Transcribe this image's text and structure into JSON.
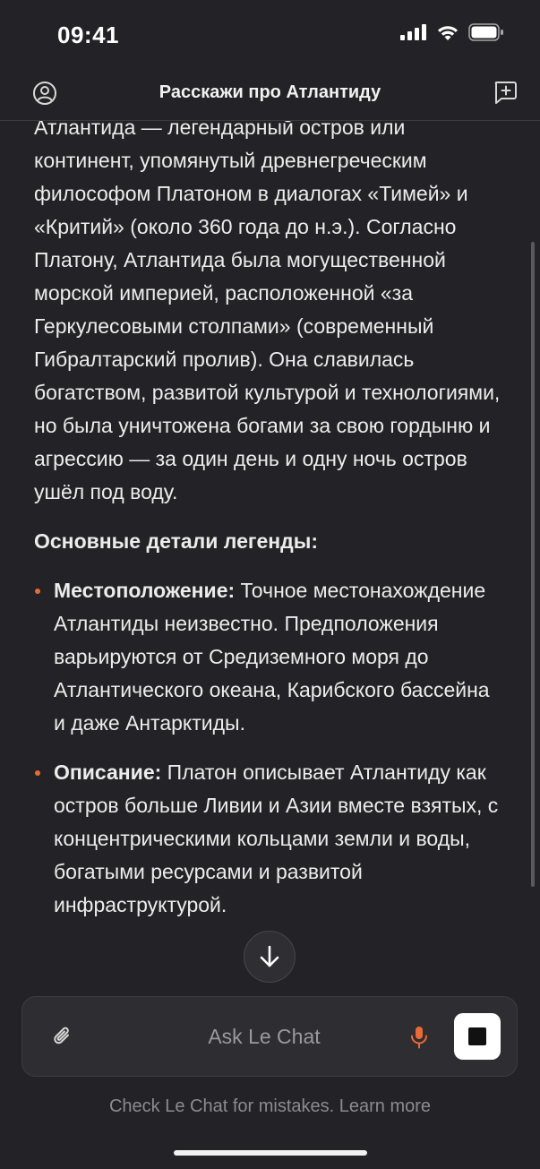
{
  "status_bar": {
    "time": "09:41"
  },
  "header": {
    "title": "Расскажи про Атлантиду"
  },
  "message": {
    "intro": "Атлантида — легендарный остров или континент, упомянутый древнегреческим философом Платоном в диалогах «Тимей» и «Критий» (около 360 года до н.э.). Согласно Платону, Атлантида была могущественной морской империей, расположенной «за Геркулесовыми столпами» (современный Гибралтарский пролив). Она славилась богатством, развитой культурой и технологиями, но была уничтожена богами за свою гордыню и агрессию — за один день и одну ночь остров ушёл под воду.",
    "section_heading": "Основные детали легенды:",
    "bullets": [
      {
        "label": "Местоположение:",
        "text": " Точное местонахождение Атлантиды неизвестно. Предположения варьируются от Средиземного моря до Атлантического океана, Карибского бассейна и даже Антарктиды."
      },
      {
        "label": "Описание:",
        "text": " Платон описывает Атлантиду как остров больше Ливии и Азии вместе взятых, с концентрическими кольцами земли и воды, богатыми ресурсами и развитой инфраструктурой."
      }
    ]
  },
  "composer": {
    "placeholder": "Ask Le Chat"
  },
  "disclaimer": "Check Le Chat for mistakes. Learn more",
  "icons": {
    "profile": "profile-icon",
    "new_chat": "new-chat-icon",
    "attach": "paperclip-icon",
    "mic": "microphone-icon",
    "stop": "stop-icon",
    "scroll_down": "arrow-down-icon"
  },
  "colors": {
    "background": "#232226",
    "accent": "#e86a35",
    "text": "#ececec",
    "muted": "#8c8b8f"
  }
}
